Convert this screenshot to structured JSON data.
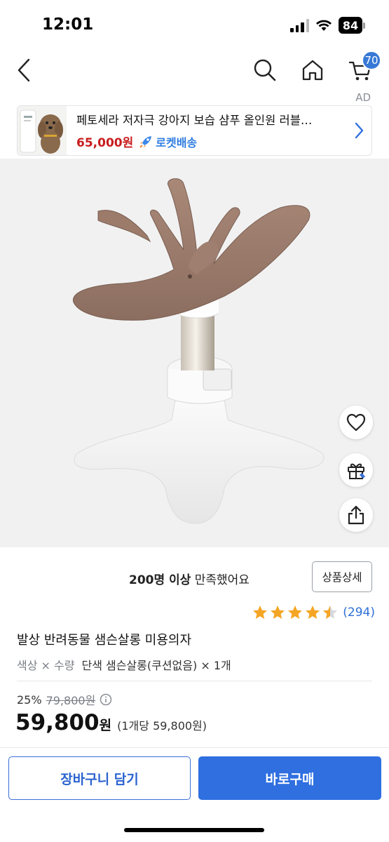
{
  "status_bar": {
    "time": "12:01",
    "battery": "84"
  },
  "nav": {
    "cart_count": "70"
  },
  "ad": {
    "label": "AD",
    "title": "페토세라 저자극 강아지 보습 샴푸 올인원 러블…",
    "price": "65,000원",
    "shipping": "로켓배송"
  },
  "satisfaction": {
    "count_text": "200명 이상",
    "rest_text": " 만족했어요"
  },
  "detail_button": "상품상세",
  "rating": {
    "stars": 4.5,
    "review_count": "(294)"
  },
  "product": {
    "title": "발상 반려동물 샘슨살롱 미용의자",
    "option_label": "색상 × 수량",
    "option_value": "단색 샘슨살롱(쿠션없음) × 1개"
  },
  "price": {
    "discount": "25%",
    "original": "79,800원",
    "final": "59,800",
    "final_unit": "원",
    "unit_price": "(1개당 59,800원)"
  },
  "buttons": {
    "cart": "장바구니 담기",
    "buy": "바로구매"
  },
  "colors": {
    "accent": "#2f6fe0",
    "price_red": "#c81d1d",
    "star": "#f5a524"
  },
  "icons": [
    "back-icon",
    "search-icon",
    "home-icon",
    "cart-icon",
    "heart-icon",
    "gift-icon",
    "share-icon",
    "info-icon",
    "rocket-icon",
    "chevron-right-icon"
  ]
}
